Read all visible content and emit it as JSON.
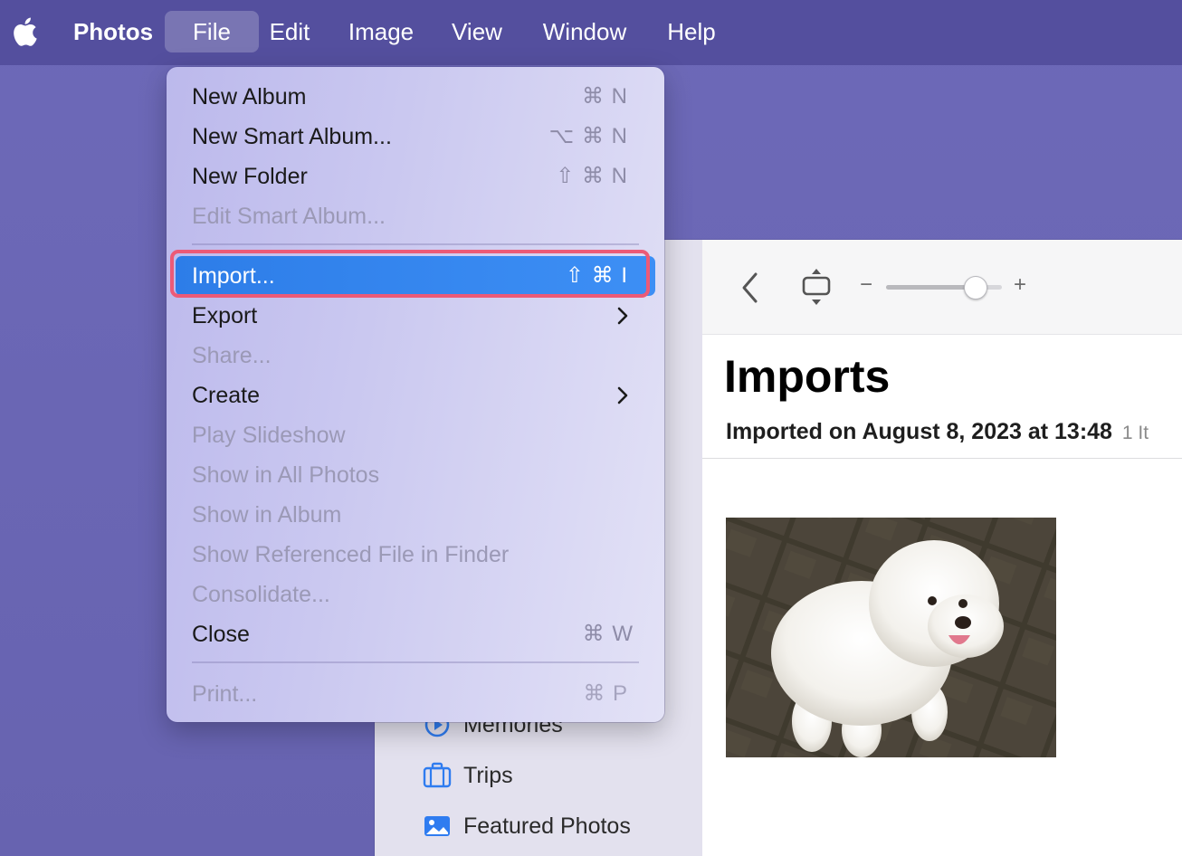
{
  "menubar": {
    "apple_icon": "apple-logo-icon",
    "items": [
      {
        "label": "Photos"
      },
      {
        "label": "File"
      },
      {
        "label": "Edit"
      },
      {
        "label": "Image"
      },
      {
        "label": "View"
      },
      {
        "label": "Window"
      },
      {
        "label": "Help"
      }
    ],
    "active_menu": "File"
  },
  "file_menu": {
    "items": [
      {
        "label": "New Album",
        "shortcut": "⌘ N",
        "enabled": true
      },
      {
        "label": "New Smart Album...",
        "shortcut": "⌥ ⌘ N",
        "enabled": true
      },
      {
        "label": "New Folder",
        "shortcut": "⇧ ⌘ N",
        "enabled": true
      },
      {
        "label": "Edit Smart Album...",
        "shortcut": "",
        "enabled": false
      },
      {
        "label": "Import...",
        "shortcut": "⇧ ⌘ I",
        "enabled": true,
        "highlighted": true
      },
      {
        "label": "Export",
        "submenu": true,
        "enabled": true
      },
      {
        "label": "Share...",
        "enabled": false
      },
      {
        "label": "Create",
        "submenu": true,
        "enabled": true
      },
      {
        "label": "Play Slideshow",
        "enabled": false
      },
      {
        "label": "Show in All Photos",
        "enabled": false
      },
      {
        "label": "Show in Album",
        "enabled": false
      },
      {
        "label": "Show Referenced File in Finder",
        "enabled": false
      },
      {
        "label": "Consolidate...",
        "enabled": false
      },
      {
        "label": "Close",
        "shortcut": "⌘ W",
        "enabled": true
      },
      {
        "label": "Print...",
        "shortcut": "⌘ P",
        "enabled": false
      }
    ]
  },
  "sidebar": {
    "items": [
      {
        "label": "Memories",
        "icon": "memories-icon"
      },
      {
        "label": "Trips",
        "icon": "suitcase-icon"
      },
      {
        "label": "Featured Photos",
        "icon": "photo-icon"
      }
    ]
  },
  "toolbar": {
    "zoom_minus": "−",
    "zoom_plus": "+",
    "zoom_level": 0.78
  },
  "content": {
    "title": "Imports",
    "subtitle_date": "Imported on August 8, 2023 at 13:48",
    "subtitle_count": "1 It"
  },
  "colors": {
    "menubar_bg": "#544f9e",
    "highlight_blue": "#3d8ff5",
    "annotation_ring": "#ec5a77"
  }
}
